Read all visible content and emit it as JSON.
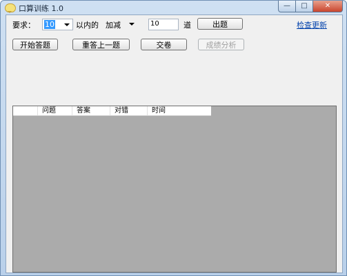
{
  "window": {
    "title": "口算训练 1.0"
  },
  "caption": {
    "minimize": "—",
    "maximize": "□",
    "close": "✕"
  },
  "form": {
    "requirement_label": "要求：",
    "range_value": "10",
    "range_suffix_label": "以内的",
    "operation_value": "加减",
    "count_value": "10",
    "count_unit_label": "道",
    "generate_button": "出题",
    "check_update_link": "检查更新"
  },
  "actions": {
    "start": "开始答题",
    "redo_previous": "重答上一题",
    "submit": "交卷",
    "analysis": "成绩分析"
  },
  "table": {
    "columns": [
      "",
      "问题",
      "答案",
      "对错",
      "时间"
    ]
  }
}
